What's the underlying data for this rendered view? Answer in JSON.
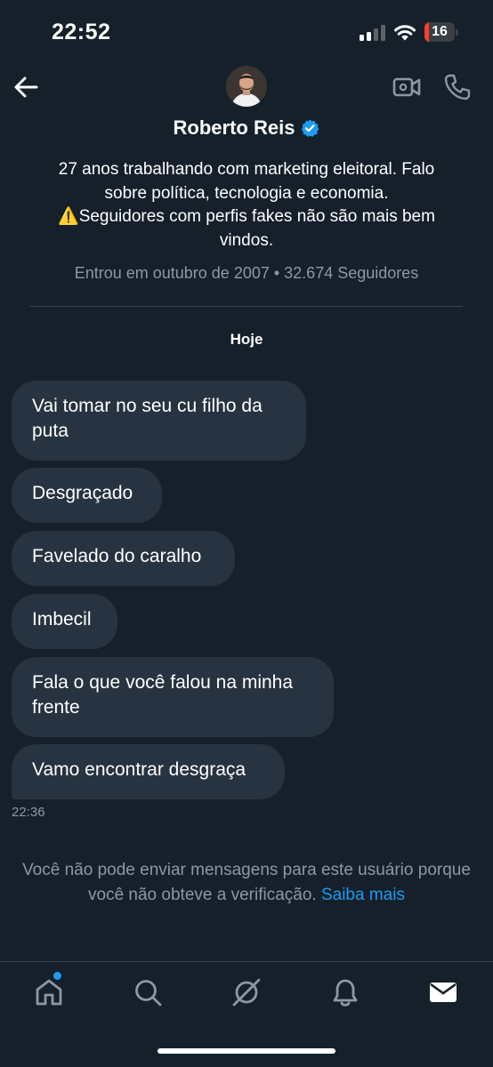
{
  "status_bar": {
    "time": "22:52",
    "battery_level": "16",
    "battery_fraction": 0.16
  },
  "header": {
    "back_icon": "arrow-left-icon",
    "video_icon": "video-call-icon",
    "phone_icon": "phone-icon"
  },
  "profile": {
    "name": "Roberto Reis",
    "verified": true,
    "bio_lines": [
      "27 anos trabalhando com marketing eleitoral. Falo",
      "sobre política, tecnologia e economia.",
      "⚠️Seguidores com perfis fakes não são mais bem",
      "vindos."
    ],
    "joined": "Entrou em outubro de 2007 • 32.674 Seguidores"
  },
  "conversation": {
    "date_separator": "Hoje",
    "messages": [
      {
        "text": "Vai tomar no seu cu filho da puta"
      },
      {
        "text": "Desgraçado"
      },
      {
        "text": "Favelado do caralho"
      },
      {
        "text": "Imbecil"
      },
      {
        "text": "Fala o que você falou na minha frente"
      },
      {
        "text": "Vamo encontrar desgraça"
      }
    ],
    "last_time": "22:36"
  },
  "notice": {
    "text": "Você não pode enviar mensagens para este usuário porque você não obteve a verificação.",
    "link": "Saiba mais"
  },
  "bottom_nav": {
    "items": [
      "home-icon",
      "search-icon",
      "grok-icon",
      "notifications-icon",
      "messages-icon"
    ]
  },
  "colors": {
    "background": "#15202b",
    "bubble": "#273340",
    "muted": "#8b98a5",
    "accent": "#1d9bf0",
    "battery_low": "#ff3b30"
  }
}
